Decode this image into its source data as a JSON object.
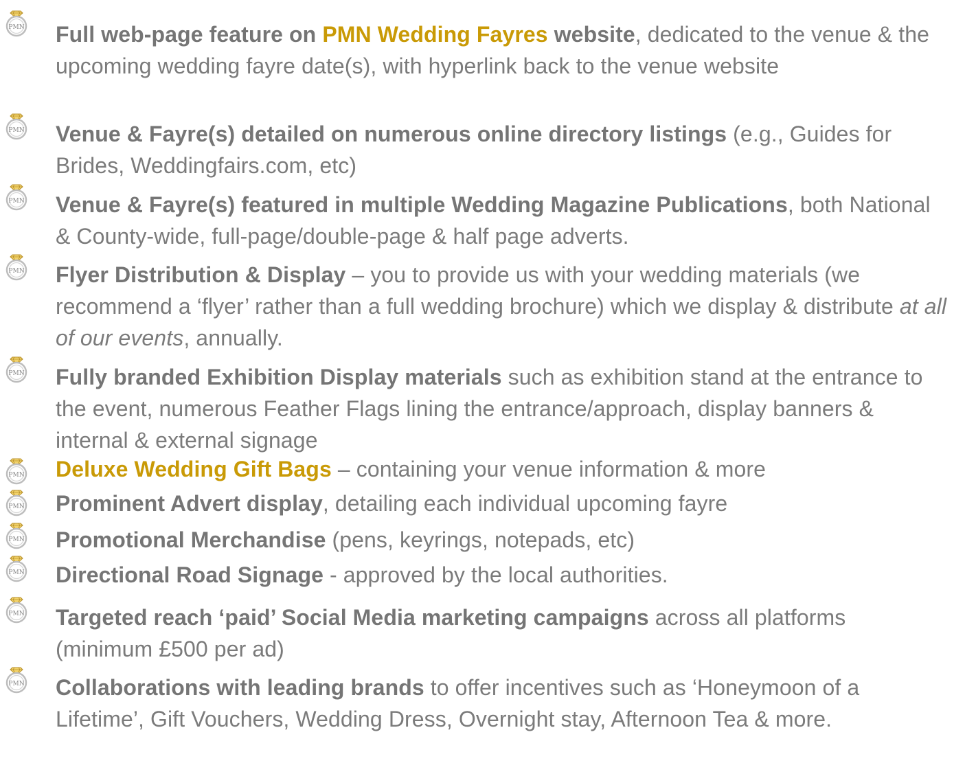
{
  "colors": {
    "text": "#7b7b7b",
    "bold_text": "#757575",
    "accent_gold": "#c99a06",
    "bullet_ring": "#c4c4c4",
    "bullet_gem": "#e0b43a"
  },
  "bullet_icon": "pmn-ring-logo-icon",
  "items": [
    {
      "bold_a": "Full web-page feature on ",
      "bold_gold": "PMN Wedding Fayres",
      "bold_b": " website",
      "text": ", dedicated to the venue & the upcoming wedding fayre date(s), with hyperlink back to the venue website"
    },
    {
      "bold": "Venue & Fayre(s) detailed on numerous online directory listings",
      "text": " (e.g., Guides for Brides, Weddingfairs.com, etc)"
    },
    {
      "bold": "Venue & Fayre(s) featured in multiple Wedding Magazine Publications",
      "text": ", both National & County-wide, full-page/double-page & half page adverts."
    },
    {
      "bold": "Flyer Distribution & Display",
      "text": " – you to provide us with your wedding materials (we recommend a ‘flyer’ rather than a full wedding brochure) which we display & distribute ",
      "italic": "at all of our events",
      "text_after": ", annually."
    },
    {
      "bold": "Fully branded Exhibition Display materials",
      "text": " such as exhibition stand at the entrance to the event, numerous Feather Flags lining the entrance/approach, display banners & internal & external signage"
    },
    {
      "bold_gold": "Deluxe Wedding Gift Bags",
      "text": " – containing your venue information & more"
    },
    {
      "bold": "Prominent Advert display",
      "text": ", detailing each individual upcoming fayre"
    },
    {
      "bold": "Promotional Merchandise",
      "text": " (pens, keyrings, notepads, etc)"
    },
    {
      "bold": "Directional Road Signage",
      "text": " - approved by the local authorities."
    },
    {
      "bold": "Targeted reach ‘paid’ Social Media marketing campaigns",
      "text": " across all platforms (minimum £500 per ad)"
    },
    {
      "bold": "Collaborations with leading brands",
      "text": " to offer incentives such as ‘Honeymoon of a Lifetime’, Gift Vouchers, Wedding Dress, Overnight stay, Afternoon Tea & more."
    }
  ]
}
